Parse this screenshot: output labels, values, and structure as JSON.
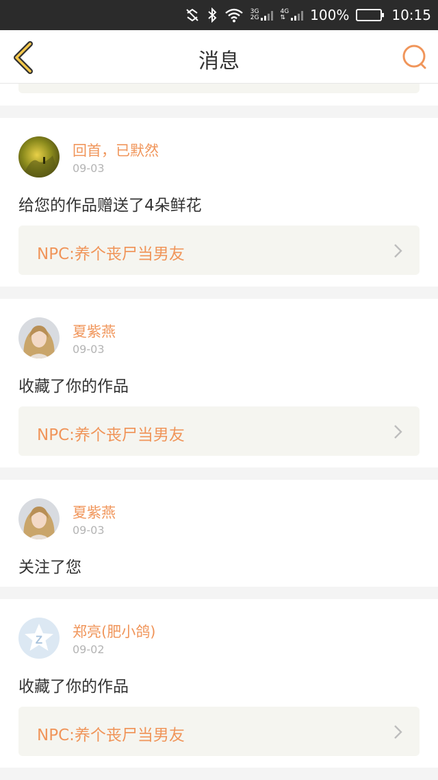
{
  "status_bar": {
    "net_top": "3G",
    "net_bottom": "2G",
    "net2": "4G",
    "battery": "100%",
    "time": "10:15"
  },
  "header": {
    "title": "消息"
  },
  "colors": {
    "accent": "#f0955a",
    "chip_bg": "#f5f5f0",
    "page_bg": "#f4f4f4"
  },
  "messages": [
    {
      "username": "回首，已默然",
      "date": "09-03",
      "action": "给您的作品赠送了4朵鲜花",
      "work": "NPC:养个丧尸当男友"
    },
    {
      "username": "夏紫燕",
      "date": "09-03",
      "action": "收藏了你的作品",
      "work": "NPC:养个丧尸当男友"
    },
    {
      "username": "夏紫燕",
      "date": "09-03",
      "action": "关注了您"
    },
    {
      "username": "郑亮(肥小鸽)",
      "date": "09-02",
      "action": "收藏了你的作品",
      "work": "NPC:养个丧尸当男友"
    }
  ]
}
